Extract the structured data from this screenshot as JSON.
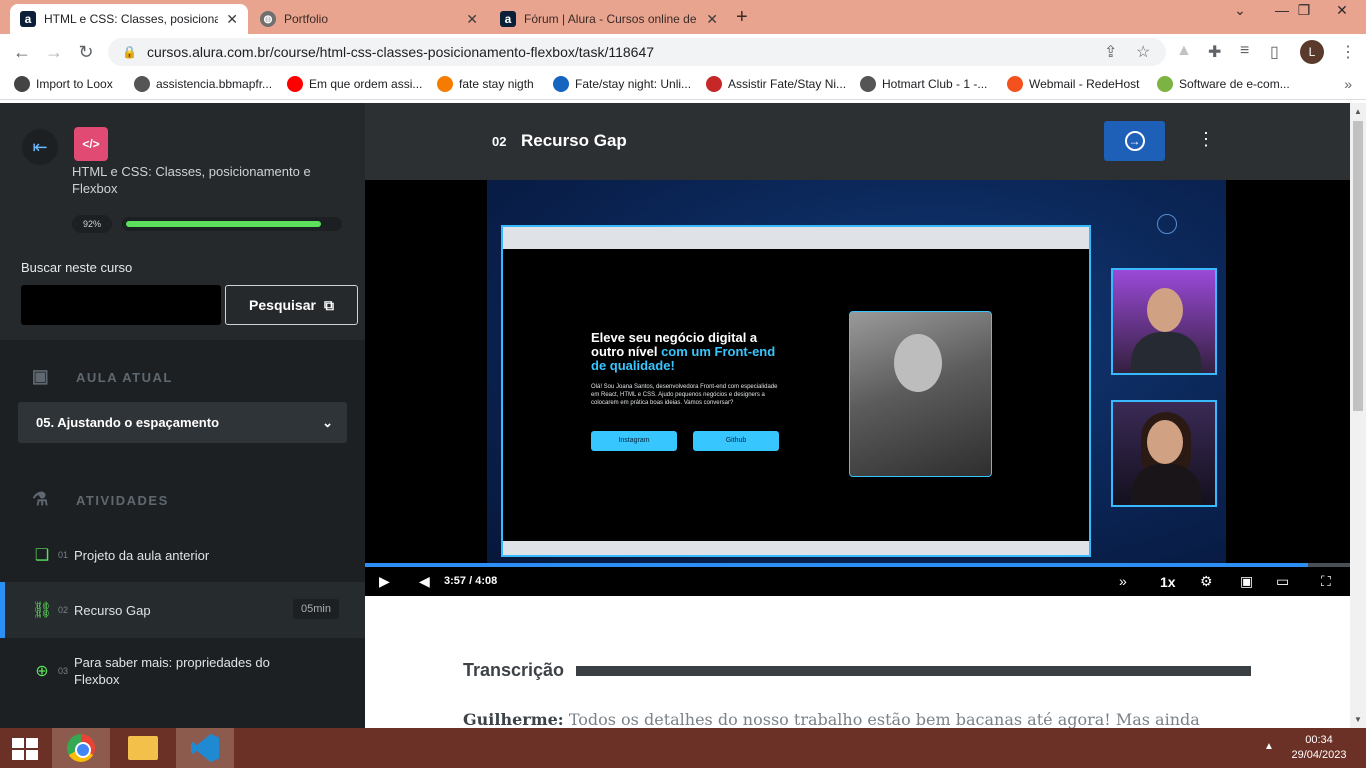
{
  "browser": {
    "tabs": [
      {
        "title": "HTML e CSS: Classes, posicionam",
        "icon": "alura-icon"
      },
      {
        "title": "Portfolio",
        "icon": "globe-icon"
      },
      {
        "title": "Fórum | Alura - Cursos online de",
        "icon": "alura-icon"
      }
    ],
    "url": "cursos.alura.com.br/course/html-css-classes-posicionamento-flexbox/task/118647",
    "profile_initial": "L",
    "bookmarks": [
      {
        "label": "Import to Loox",
        "color": "#444444"
      },
      {
        "label": "assistencia.bbmapfr...",
        "color": "#555555"
      },
      {
        "label": "Em que ordem assi...",
        "color": "#ff0000"
      },
      {
        "label": "fate stay nigth",
        "color": "#f57c00"
      },
      {
        "label": "Fate/stay night: Unli...",
        "color": "#1565c0"
      },
      {
        "label": "Assistir Fate/Stay Ni...",
        "color": "#c62828"
      },
      {
        "label": "Hotmart Club - 1 -...",
        "color": "#555555"
      },
      {
        "label": "Webmail - RedeHost",
        "color": "#f4511e"
      },
      {
        "label": "Software de e-com...",
        "color": "#7cb342"
      }
    ]
  },
  "sidebar": {
    "course_icon": "</>",
    "course_title": "HTML e CSS: Classes, posicionamento e Flexbox",
    "progress_label": "92%",
    "progress_percent": 92,
    "search_label": "Buscar neste curso",
    "search_value": "",
    "search_button": "Pesquisar",
    "current_section": "AULA ATUAL",
    "current_lesson": "05. Ajustando o espaçamento",
    "activities_section": "ATIVIDADES",
    "activities": [
      {
        "num": "01",
        "label": "Projeto da aula anterior",
        "duration": ""
      },
      {
        "num": "02",
        "label": "Recurso Gap",
        "duration": "05min"
      },
      {
        "num": "03",
        "label": "Para saber mais: propriedades do Flexbox",
        "duration": ""
      }
    ]
  },
  "lesson": {
    "number": "02",
    "title": "Recurso Gap"
  },
  "video": {
    "hero_title_1": "Eleve seu negócio digital a outro nível",
    "hero_title_2": "com um Front-end de qualidade!",
    "hero_text": "Olá! Sou Joana Santos, desenvolvedora Front-end com especialidade em React, HTML e CSS. Ajudo pequenos negócios e designers a colocarem em prática boas ideias. Vamos conversar?",
    "button_1": "Instagram",
    "button_2": "Github",
    "current_time": "3:57",
    "separator": "/",
    "duration": "4:08",
    "played_fraction": 0.957,
    "speed": "1x"
  },
  "transcript": {
    "heading": "Transcrição",
    "speaker": "Guilherme:",
    "text": "Todos os detalhes do nosso trabalho estão bem bacanas até agora! Mas ainda está"
  },
  "taskbar": {
    "time": "00:34",
    "date": "29/04/2023"
  }
}
